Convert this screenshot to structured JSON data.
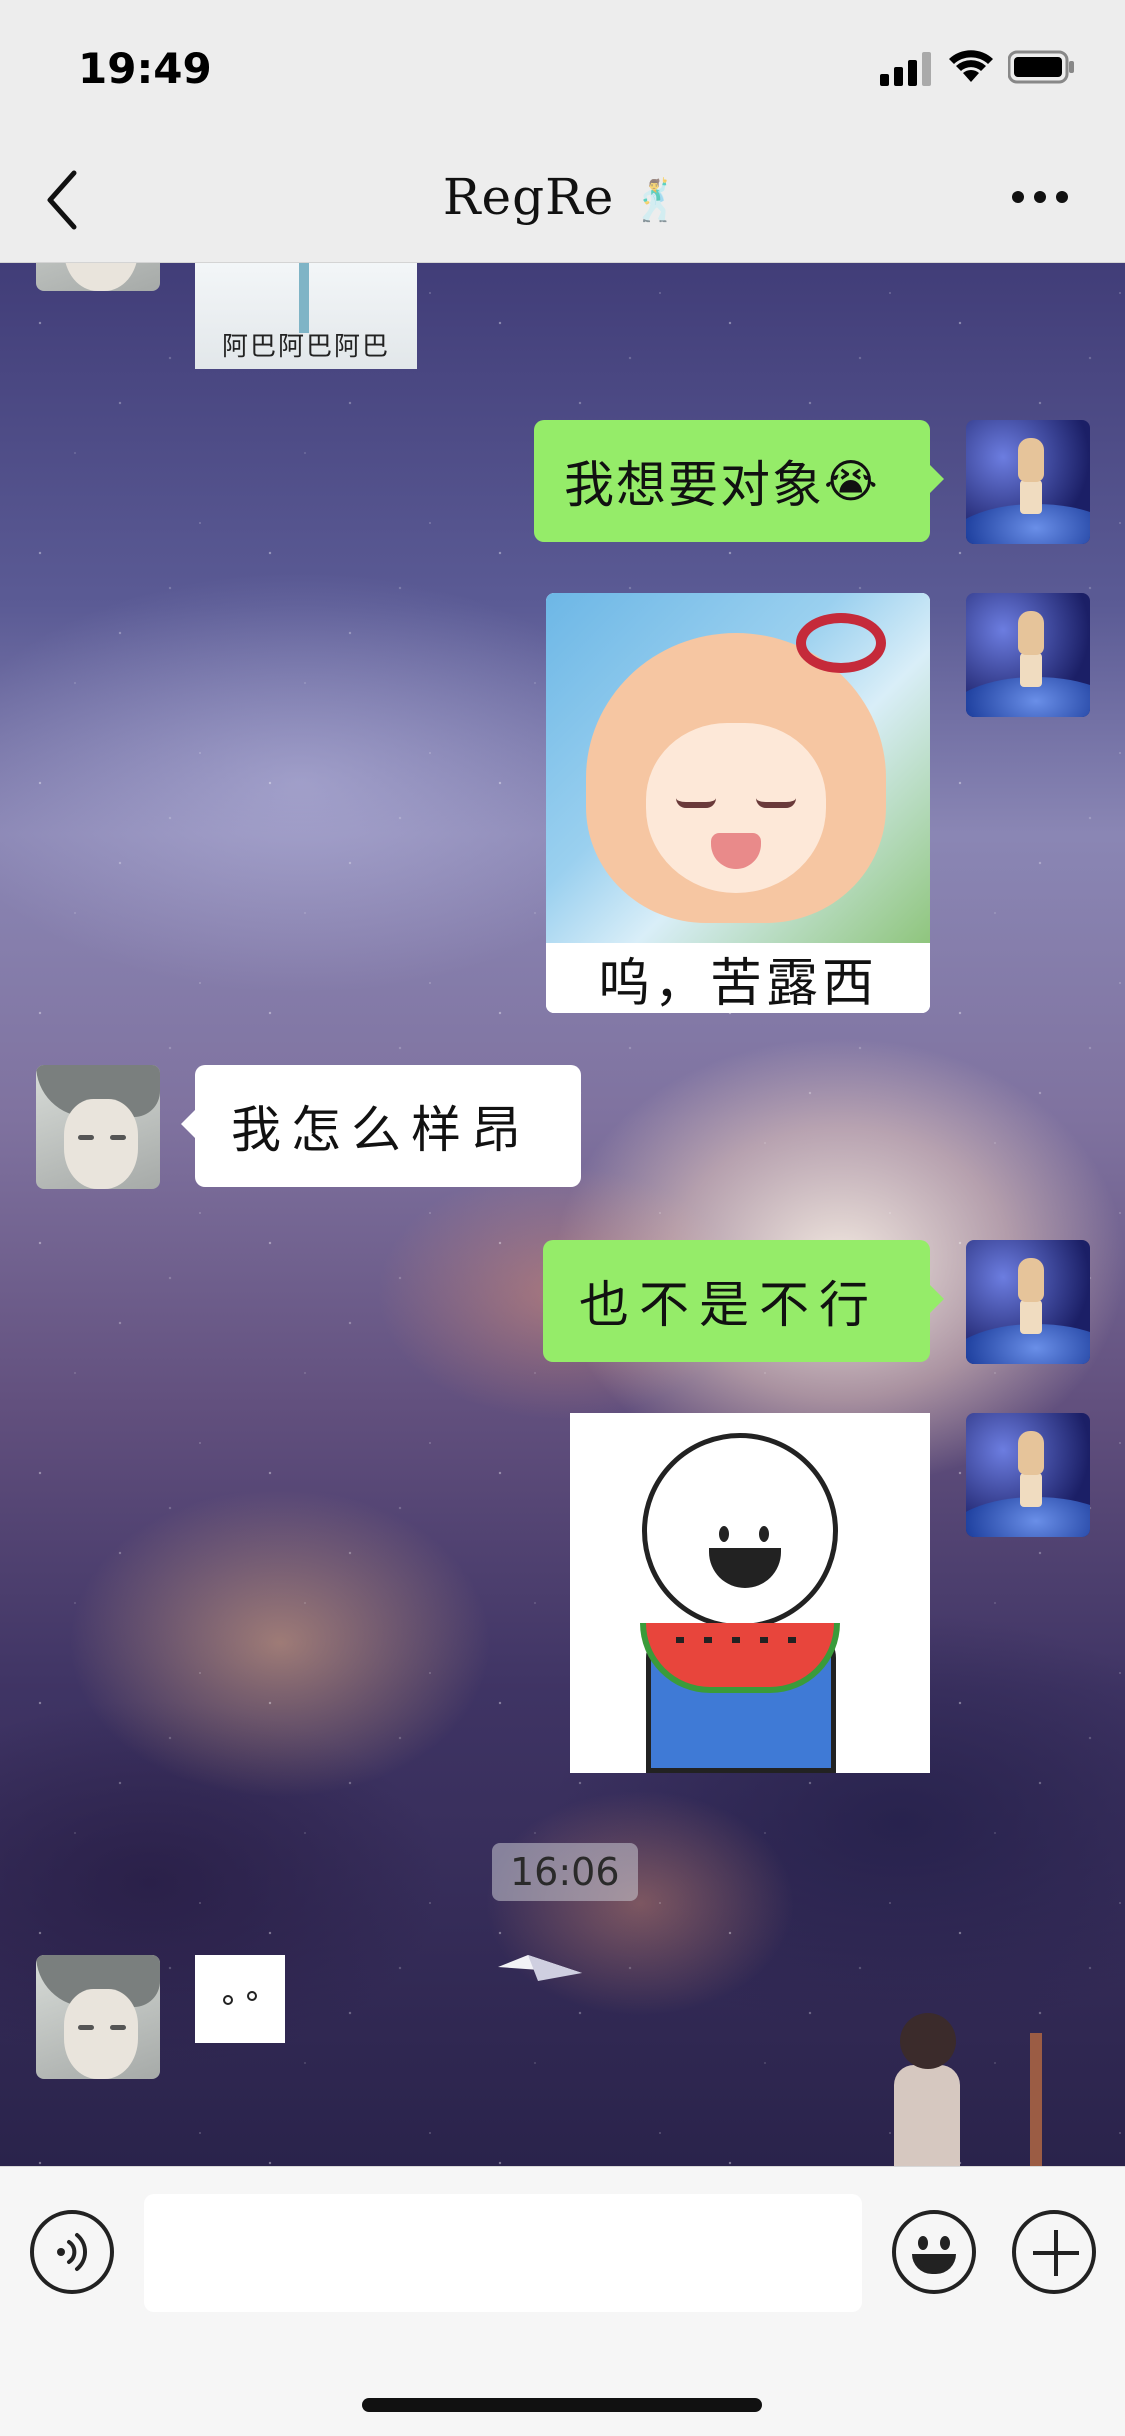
{
  "status_bar": {
    "time": "19:49"
  },
  "header": {
    "title": "RegRe",
    "title_emoji": "🕺"
  },
  "messages": [
    {
      "side": "left",
      "type": "sticker",
      "caption": "阿巴阿巴阿巴"
    },
    {
      "side": "right",
      "type": "text",
      "text": "我想要对象",
      "emoji": "😭"
    },
    {
      "side": "right",
      "type": "sticker",
      "caption": "呜，苦露西"
    },
    {
      "side": "left",
      "type": "text",
      "text": "我怎么样昂"
    },
    {
      "side": "right",
      "type": "text",
      "text": "也不是不行"
    },
    {
      "side": "right",
      "type": "sticker",
      "caption": ""
    },
    {
      "type": "timestamp",
      "text": "16:06"
    },
    {
      "side": "left",
      "type": "sticker",
      "caption": ""
    }
  ],
  "input": {
    "value": "",
    "placeholder": ""
  },
  "colors": {
    "sent_bubble": "#95ec69",
    "received_bubble": "#ffffff",
    "top_bar": "#ededed",
    "input_bar": "#f6f6f6"
  },
  "icons": [
    "back-icon",
    "more-icon",
    "voice-icon",
    "emoji-icon",
    "add-icon",
    "signal-icon",
    "wifi-icon",
    "battery-icon"
  ]
}
